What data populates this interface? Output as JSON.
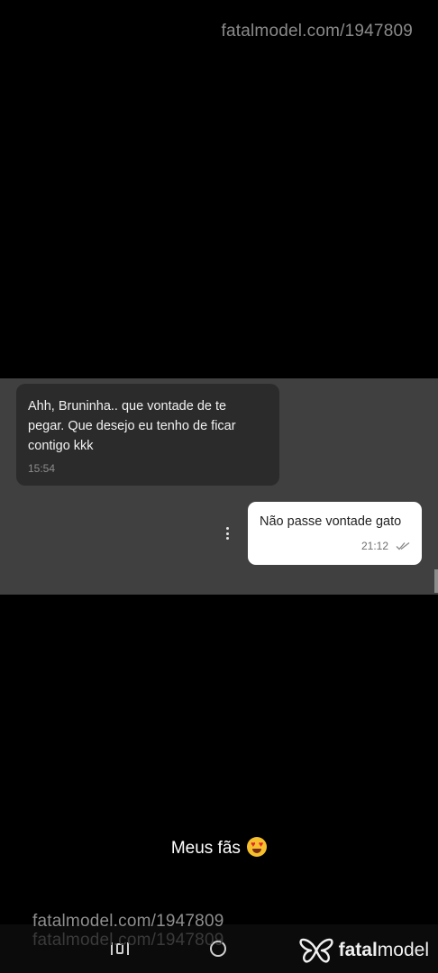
{
  "watermark": {
    "top_text": "fatalmodel.com/1947809",
    "bottom_text": "fatalmodel.com/1947809",
    "bottom_shadow_text": "fatalmodel.com/1947809"
  },
  "chat": {
    "incoming": {
      "text": "Ahh, Bruninha.. que vontade de te\npegar. Que desejo eu tenho de ficar\ncontigo kkk",
      "time": "15:54"
    },
    "outgoing": {
      "text": "Não passe vontade gato",
      "time": "21:12",
      "status_icon": "double-check-icon"
    },
    "menu_icon": "more-vertical-icon"
  },
  "caption": {
    "text": "Meus fãs",
    "emoji": "heart-eyes-emoji"
  },
  "nav": {
    "recents_icon": "recents-icon",
    "home_icon": "home-icon"
  },
  "brand": {
    "logo_icon": "butterfly-logo-icon",
    "name_bold": "fatal",
    "name_regular": "model"
  },
  "colors": {
    "background": "#000000",
    "chat_panel": "#404040",
    "incoming_bubble": "#2b2b2b",
    "outgoing_bubble": "#ffffff"
  }
}
